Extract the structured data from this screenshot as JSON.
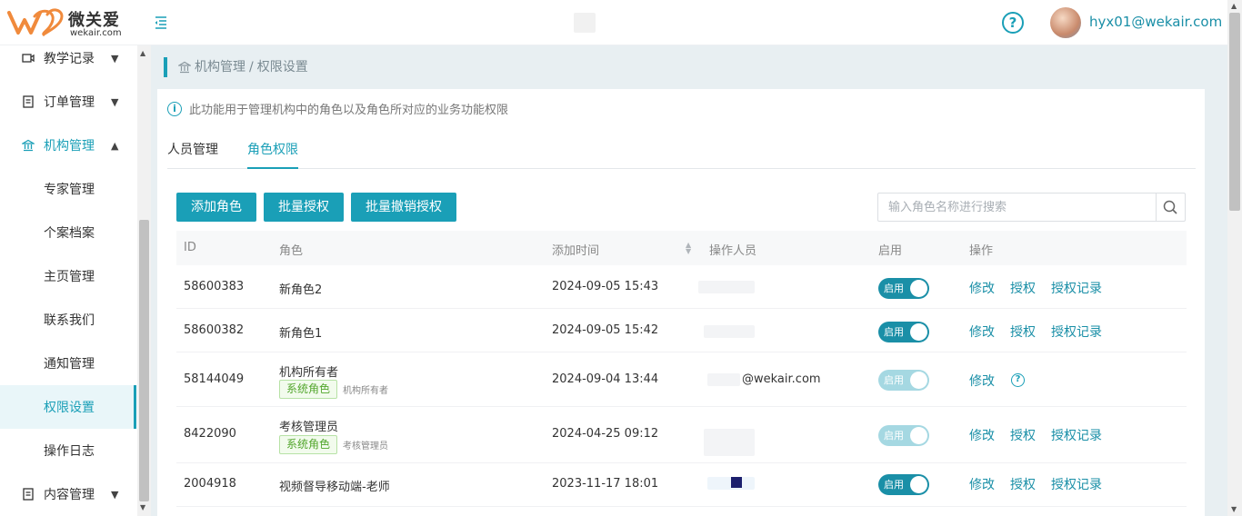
{
  "header": {
    "logo_text": "微关爱",
    "logo_sub": "wekair.com",
    "user_name": "hyx01@wekair.com"
  },
  "sidebar": {
    "items": [
      {
        "label": "教学记录",
        "icon": "video-icon"
      },
      {
        "label": "订单管理",
        "icon": "order-icon"
      },
      {
        "label": "机构管理",
        "icon": "institution-icon"
      },
      {
        "label": "专家管理"
      },
      {
        "label": "个案档案"
      },
      {
        "label": "主页管理"
      },
      {
        "label": "联系我们"
      },
      {
        "label": "通知管理"
      },
      {
        "label": "权限设置"
      },
      {
        "label": "操作日志"
      },
      {
        "label": "内容管理",
        "icon": "content-icon"
      }
    ]
  },
  "breadcrumb": {
    "parent": "机构管理",
    "sep": "/",
    "current": "权限设置"
  },
  "info_text": "此功能用于管理机构中的角色以及角色所对应的业务功能权限",
  "tabs": [
    "人员管理",
    "角色权限"
  ],
  "buttons": {
    "add": "添加角色",
    "grant": "批量授权",
    "revoke": "批量撤销授权"
  },
  "search": {
    "placeholder": "输入角色名称进行搜索"
  },
  "table": {
    "headers": [
      "ID",
      "角色",
      "添加时间",
      "操作人员",
      "启用",
      "操作"
    ],
    "rows": [
      {
        "id": "58600383",
        "role": "新角色2",
        "time": "2024-09-05 15:43",
        "operator": "",
        "toggle": "启用",
        "actions": [
          "修改",
          "授权",
          "授权记录"
        ]
      },
      {
        "id": "58600382",
        "role": "新角色1",
        "time": "2024-09-05 15:42",
        "operator": "",
        "toggle": "启用",
        "actions": [
          "修改",
          "授权",
          "授权记录"
        ]
      },
      {
        "id": "58144049",
        "role": "机构所有者",
        "tag": "系统角色",
        "tag_desc": "机构所有者",
        "time": "2024-09-04 13:44",
        "operator": "@wekair.com",
        "toggle": "启用",
        "actions": [
          "修改"
        ]
      },
      {
        "id": "8422090",
        "role": "考核管理员",
        "tag": "系统角色",
        "tag_desc": "考核管理员",
        "time": "2024-04-25 09:12",
        "operator": "",
        "toggle": "启用",
        "actions": [
          "修改",
          "授权",
          "授权记录"
        ]
      },
      {
        "id": "2004918",
        "role": "视频督导移动端-老师",
        "time": "2023-11-17 18:01",
        "operator": "",
        "toggle": "启用",
        "actions": [
          "修改",
          "授权",
          "授权记录"
        ]
      }
    ]
  },
  "colors": {
    "accent": "#1a9fb7",
    "tag_green": "#52a62c"
  }
}
